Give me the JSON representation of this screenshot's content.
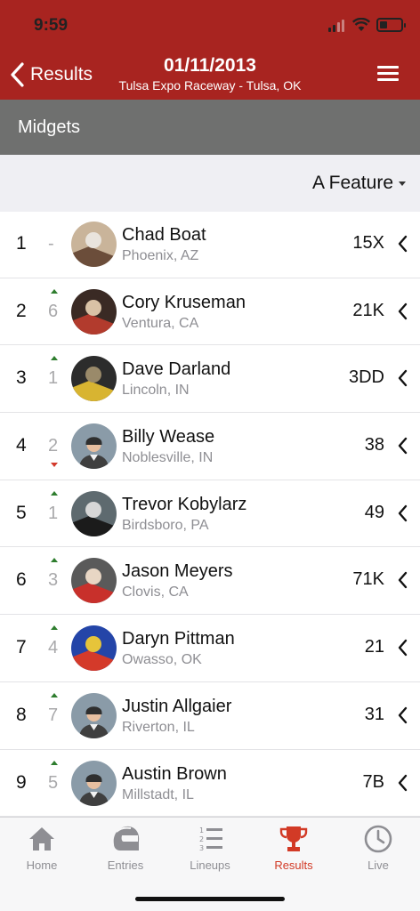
{
  "status_bar": {
    "time": "9:59"
  },
  "nav": {
    "back_label": "Results",
    "title": "01/11/2013",
    "subtitle": "Tulsa Expo Raceway - Tulsa, OK"
  },
  "class_name": "Midgets",
  "filter": {
    "selected": "A Feature"
  },
  "colors": {
    "brand": "#a82420",
    "accent": "#d23a26",
    "gain": "#2e7d2e",
    "loss": "#d33a2c"
  },
  "results": [
    {
      "position": "1",
      "change": "-",
      "direction": "none",
      "name": "Chad Boat",
      "hometown": "Phoenix, AZ",
      "car": "15X",
      "avatar": "photo"
    },
    {
      "position": "2",
      "change": "6",
      "direction": "up",
      "name": "Cory Kruseman",
      "hometown": "Ventura, CA",
      "car": "21K",
      "avatar": "photo"
    },
    {
      "position": "3",
      "change": "1",
      "direction": "up",
      "name": "Dave Darland",
      "hometown": "Lincoln, IN",
      "car": "3DD",
      "avatar": "photo"
    },
    {
      "position": "4",
      "change": "2",
      "direction": "down",
      "name": "Billy Wease",
      "hometown": "Noblesville, IN",
      "car": "38",
      "avatar": "placeholder"
    },
    {
      "position": "5",
      "change": "1",
      "direction": "up",
      "name": "Trevor Kobylarz",
      "hometown": "Birdsboro, PA",
      "car": "49",
      "avatar": "photo"
    },
    {
      "position": "6",
      "change": "3",
      "direction": "up",
      "name": "Jason Meyers",
      "hometown": "Clovis, CA",
      "car": "71K",
      "avatar": "photo"
    },
    {
      "position": "7",
      "change": "4",
      "direction": "up",
      "name": "Daryn Pittman",
      "hometown": "Owasso, OK",
      "car": "21",
      "avatar": "photo"
    },
    {
      "position": "8",
      "change": "7",
      "direction": "up",
      "name": "Justin Allgaier",
      "hometown": "Riverton, IL",
      "car": "31",
      "avatar": "placeholder"
    },
    {
      "position": "9",
      "change": "5",
      "direction": "up",
      "name": "Austin Brown",
      "hometown": "Millstadt, IL",
      "car": "7B",
      "avatar": "placeholder"
    }
  ],
  "tabs": [
    {
      "label": "Home",
      "icon": "home-icon",
      "active": false
    },
    {
      "label": "Entries",
      "icon": "helmet-icon",
      "active": false
    },
    {
      "label": "Lineups",
      "icon": "lineups-icon",
      "active": false
    },
    {
      "label": "Results",
      "icon": "trophy-icon",
      "active": true
    },
    {
      "label": "Live",
      "icon": "clock-icon",
      "active": false
    }
  ]
}
